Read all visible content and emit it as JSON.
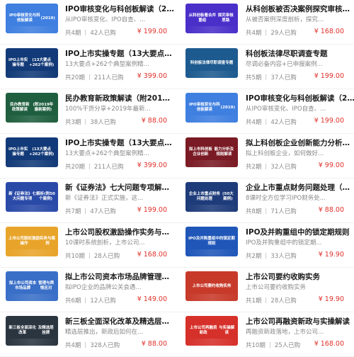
{
  "courses": [
    {
      "thumb_lines": [
        "IPO审核变化与科创板解读",
        "(2019)"
      ],
      "thumb_color": "#3f7fe0",
      "title": "IPO审核变化与科创板解读（20...",
      "subtitle": "从IPO审核变化、IPO自查、...",
      "lessons": "共4期",
      "buyers": "42人已购",
      "price": "¥ 199.00"
    },
    {
      "thumb_lines": [
        "从科创板看合并重组",
        "探究审核思路"
      ],
      "thumb_color": "#4a2fc9",
      "title": "从科创板被否决案例探究审核思路",
      "subtitle": "从被否案例深度剖析，探究...",
      "lessons": "共4期",
      "buyers": "29人已购",
      "price": "¥ 168.00"
    },
    {
      "thumb_lines": [
        "IPO上市实操专题",
        "(13大要点+262个案例)"
      ],
      "thumb_color": "#123a78",
      "title": "IPO上市实操专题（13大要点+2...",
      "subtitle": "13大要点+262个典型案例精...",
      "lessons": "共20期",
      "buyers": "211人已购",
      "price": "¥ 399.00"
    },
    {
      "thumb_lines": [
        "科创板法律尽职调查专题"
      ],
      "thumb_color": "#1d5a8f",
      "title": "科创板法律尽职调查专题",
      "subtitle": "尽调必备内容+已申报案例...",
      "lessons": "共5期",
      "buyers": "37人已购",
      "price": "¥ 199.00"
    },
    {
      "thumb_lines": [
        "民办教育新政策解读",
        "(附2019年最新案例)"
      ],
      "thumb_color": "#1f5f3f",
      "title": "民办教育新政策解读（附2019...",
      "subtitle": "100%干货分享+2019年最新...",
      "lessons": "共3期",
      "buyers": "38人已购",
      "price": "¥ 88.00"
    },
    {
      "thumb_lines": [
        "IPO审核变化与科创板解读",
        "(2019)"
      ],
      "thumb_color": "#3f7fe0",
      "title": "IPO审核变化与科创板解读（20...",
      "subtitle": "从IPO审核变化、IPO自查、...",
      "lessons": "共4期",
      "buyers": "42人已购",
      "price": "¥ 199.00"
    },
    {
      "thumb_lines": [
        "IPO上市实操专题",
        "(13大要点+262个案例)"
      ],
      "thumb_color": "#123a78",
      "title": "IPO上市实操专题（13大要点+2...",
      "subtitle": "13大要点+262个典型案例精...",
      "lessons": "共20期",
      "buyers": "211人已购",
      "price": "¥ 399.00"
    },
    {
      "thumb_lines": [
        "拟上市科创板企业创新",
        "能力分析及规则解读"
      ],
      "thumb_color": "#7a1a24",
      "title": "拟上科创板企业创新能力分析及...",
      "subtitle": "拟上科创板企业，如何做好...",
      "lessons": "共2期",
      "buyers": "32人已购",
      "price": "¥ 99.00"
    },
    {
      "thumb_lines": [
        "新《证券法》七大问题专项",
        "解析(附50个案例)"
      ],
      "thumb_color": "#2a4aa8",
      "title": "新《证券法》七大问题专项解析...",
      "subtitle": "新《证券法》正式实施，这...",
      "lessons": "共7期",
      "buyers": "47人已购",
      "price": "¥ 199.00"
    },
    {
      "thumb_lines": [
        "企业上市重点财务问题处理",
        "(50大案例)"
      ],
      "thumb_color": "#1e3b7a",
      "title": "企业上市重点财务问题处理（50...",
      "subtitle": "8课时全方位学习IPO财务处...",
      "lessons": "共8期",
      "buyers": "71人已购",
      "price": "¥ 88.00"
    },
    {
      "thumb_lines": [
        "上市公司股权激励操作",
        "实务与案例"
      ],
      "thumb_color": "#e8a42a",
      "title": "上市公司股权激励操作实务与案例",
      "subtitle": "10课时系统剖析，上市公司...",
      "lessons": "共10期",
      "buyers": "28人已购",
      "price": "¥ 168.00"
    },
    {
      "thumb_lines": [
        "IPO及并购重组中的锁定期规则"
      ],
      "thumb_color": "#1f56b8",
      "title": "IPO及并购重组中的锁定期规则",
      "subtitle": "IPO及并购重组中的锁定期...",
      "lessons": "共2期",
      "buyers": "33人已购",
      "price": "¥ 19.90"
    },
    {
      "thumb_lines": [
        "拟上市公司资本市场品牌",
        "管理与舆情应对"
      ],
      "thumb_color": "#3a6fc8",
      "title": "拟上市公司资本市场品牌管理与...",
      "subtitle": "拟IPO企业的品牌公关会遇...",
      "lessons": "共6期",
      "buyers": "12人已购",
      "price": "¥ 149.00"
    },
    {
      "thumb_lines": [
        "上市公司要约收购实务"
      ],
      "thumb_color": "#c73a2a",
      "title": "上市公司要约收购实务",
      "subtitle": "上市公司要约收购实务",
      "lessons": "共1期",
      "buyers": "28人已购",
      "price": "¥ 19.90"
    },
    {
      "thumb_lines": [
        "新三板全面深化改革",
        "及精选层挂牌"
      ],
      "thumb_color": "#2a3540",
      "title": "新三板全面深化改革及精选层挂...",
      "subtitle": "精选层推出，新政后如何在...",
      "lessons": "共4期",
      "buyers": "328人已购",
      "price": "¥ 88.00"
    },
    {
      "thumb_lines": [
        "上市公司再融资新政",
        "与实操解读"
      ],
      "thumb_color": "#d6302a",
      "title": "上市公司再融资新政与实操解读",
      "subtitle": "再融资新政落地，上市公司...",
      "lessons": "共10期",
      "buyers": "25人已购",
      "price": "¥ 168.00"
    }
  ]
}
